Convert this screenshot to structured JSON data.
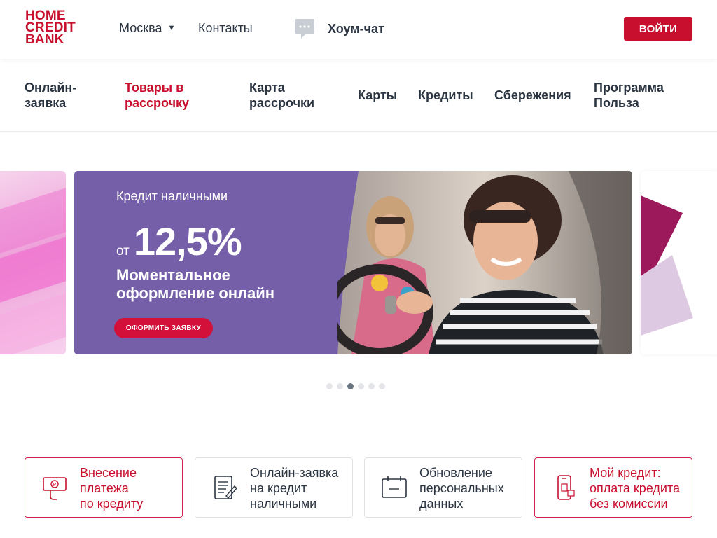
{
  "header": {
    "logo_lines": [
      "HOME",
      "CREDIT",
      "BANK"
    ],
    "city": "Москва",
    "contacts": "Контакты",
    "chat": "Хоум-чат",
    "login": "ВОЙТИ"
  },
  "nav": {
    "items": [
      {
        "label": "Онлайн-заявка",
        "line1": "Онлайн-",
        "line2": "заявка",
        "active": false
      },
      {
        "label": "Товары в рассрочку",
        "line1": "Товары в",
        "line2": "рассрочку",
        "active": true
      },
      {
        "label": "Карта рассрочки",
        "line1": "Карта",
        "line2": "рассрочки",
        "active": false
      },
      {
        "label": "Карты",
        "line1": "Карты",
        "line2": "",
        "active": false
      },
      {
        "label": "Кредиты",
        "line1": "Кредиты",
        "line2": "",
        "active": false
      },
      {
        "label": "Сбережения",
        "line1": "Сбережения",
        "line2": "",
        "active": false
      },
      {
        "label": "Программа Польза",
        "line1": "Программа",
        "line2": "Польза",
        "active": false
      }
    ]
  },
  "promo": {
    "kicker": "Кредит наличными",
    "rate_prefix": "от",
    "rate": "12,5%",
    "subtitle": "Моментальное оформление онлайн",
    "button": "ОФОРМИТЬ ЗАЯВКУ",
    "slide_count": 6,
    "active_slide": 3
  },
  "cards": [
    {
      "line1": "Внесение",
      "line2": "платежа",
      "line3": "по кредиту",
      "icon": "payment-icon",
      "style": "red"
    },
    {
      "line1": "Онлайн-заявка",
      "line2": "на кредит",
      "line3": "наличными",
      "icon": "document-icon",
      "style": "plain"
    },
    {
      "line1": "Обновление",
      "line2": "персональных",
      "line3": "данных",
      "icon": "calendar-icon",
      "style": "plain"
    },
    {
      "line1": "Мой кредит:",
      "line2": "оплата кредита",
      "line3": "без комиссии",
      "icon": "phone-icon",
      "style": "red"
    }
  ],
  "colors": {
    "brand_red": "#c8102e",
    "promo_purple": "#755fa9",
    "text_dark": "#2b3542"
  }
}
